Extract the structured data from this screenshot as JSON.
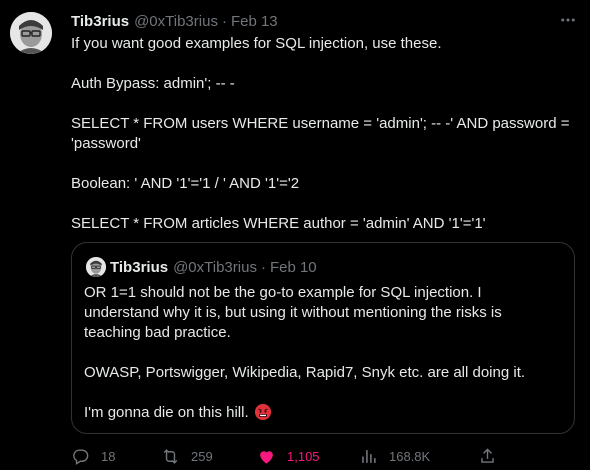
{
  "tweet": {
    "author_name": "Tib3rius",
    "author_handle": "@0xTib3rius",
    "separator": "·",
    "date": "Feb 13",
    "paragraphs": [
      "If you want good examples for SQL injection, use these.",
      "Auth Bypass: admin'; -- -",
      "SELECT * FROM users WHERE username = 'admin'; -- -' AND password = 'password'",
      "Boolean: ' AND '1'='1 / ' AND '1'='2",
      "SELECT * FROM articles WHERE author = 'admin' AND '1'='1'"
    ]
  },
  "quoted": {
    "author_name": "Tib3rius",
    "author_handle": "@0xTib3rius",
    "separator": "·",
    "date": "Feb 10",
    "paragraphs": [
      "OR 1=1 should not be the go-to example for SQL injection. I understand why it is, but using it without mentioning the risks is teaching bad practice.",
      "OWASP, Portswigger, Wikipedia, Rapid7, Snyk etc. are all doing it.",
      "I'm gonna die on this hill."
    ],
    "emoji": "angry-face-with-symbols"
  },
  "actions": {
    "replies": "18",
    "reposts": "259",
    "likes": "1,105",
    "views": "168.8K"
  },
  "icons": {
    "reply": "reply-icon",
    "repost": "repost-icon",
    "like": "heart-icon",
    "views": "views-icon",
    "share": "share-icon",
    "more": "more-icon"
  },
  "colors": {
    "background": "#000000",
    "text": "#e7e9ea",
    "secondary": "#71767b",
    "like": "#f91880",
    "border": "#2f3336"
  }
}
